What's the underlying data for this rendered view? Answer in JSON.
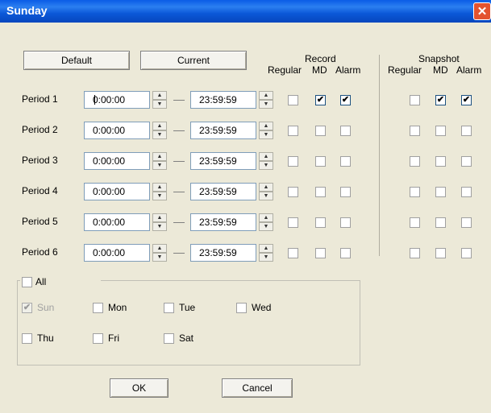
{
  "window": {
    "title": "Sunday",
    "close_glyph": "✕"
  },
  "buttons": {
    "default": "Default",
    "current": "Current",
    "ok": "OK",
    "cancel": "Cancel"
  },
  "record": {
    "title": "Record",
    "cols": [
      "Regular",
      "MD",
      "Alarm"
    ]
  },
  "snapshot": {
    "title": "Snapshot",
    "cols": [
      "Regular",
      "MD",
      "Alarm"
    ]
  },
  "periods": [
    {
      "label": "Period 1",
      "start": "0:00:00",
      "end": "23:59:59",
      "record": [
        false,
        true,
        true
      ],
      "snapshot": [
        false,
        true,
        true
      ]
    },
    {
      "label": "Period 2",
      "start": "0:00:00",
      "end": "23:59:59",
      "record": [
        false,
        false,
        false
      ],
      "snapshot": [
        false,
        false,
        false
      ]
    },
    {
      "label": "Period 3",
      "start": "0:00:00",
      "end": "23:59:59",
      "record": [
        false,
        false,
        false
      ],
      "snapshot": [
        false,
        false,
        false
      ]
    },
    {
      "label": "Period 4",
      "start": "0:00:00",
      "end": "23:59:59",
      "record": [
        false,
        false,
        false
      ],
      "snapshot": [
        false,
        false,
        false
      ]
    },
    {
      "label": "Period 5",
      "start": "0:00:00",
      "end": "23:59:59",
      "record": [
        false,
        false,
        false
      ],
      "snapshot": [
        false,
        false,
        false
      ]
    },
    {
      "label": "Period 6",
      "start": "0:00:00",
      "end": "23:59:59",
      "record": [
        false,
        false,
        false
      ],
      "snapshot": [
        false,
        false,
        false
      ]
    }
  ],
  "days": {
    "all": {
      "label": "All",
      "checked": false
    },
    "items": [
      {
        "label": "Sun",
        "checked": true,
        "disabled": true
      },
      {
        "label": "Mon",
        "checked": false,
        "disabled": false
      },
      {
        "label": "Tue",
        "checked": false,
        "disabled": false
      },
      {
        "label": "Wed",
        "checked": false,
        "disabled": false
      },
      {
        "label": "Thu",
        "checked": false,
        "disabled": false
      },
      {
        "label": "Fri",
        "checked": false,
        "disabled": false
      },
      {
        "label": "Sat",
        "checked": false,
        "disabled": false
      }
    ]
  },
  "icons": {
    "spin_up": "▲",
    "spin_down": "▼",
    "check": "✔"
  }
}
